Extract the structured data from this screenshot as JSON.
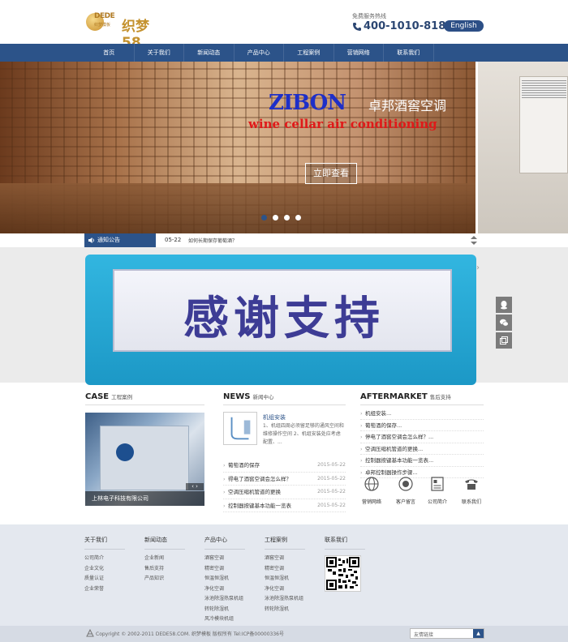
{
  "header": {
    "logo_text1": "DEDE",
    "logo_text2": "织梦模板",
    "logo_text3": "织梦58",
    "hotline_label": "免费服务热线",
    "hotline_number": "400-1010-818",
    "lang_button": "English"
  },
  "nav": {
    "items": [
      "首页",
      "关于我们",
      "新闻动态",
      "产品中心",
      "工程案例",
      "营销网络",
      "联系我们"
    ]
  },
  "banner": {
    "brand": "ZIBON",
    "brand_cn": "卓邦酒窖空调",
    "tagline": "wine cellar air conditioning",
    "button": "立即查看",
    "slide_count": 4,
    "active_slide": 1
  },
  "notice": {
    "label": "通知公告",
    "date": "05-22",
    "text": "如何长期保存葡萄酒？"
  },
  "promo": {
    "text": "感谢支持"
  },
  "case": {
    "title": "CASE",
    "subtitle": "工程案例",
    "caption": "上林电子科技有限公司",
    "nav": "‹  ›"
  },
  "news": {
    "title": "NEWS",
    "subtitle": "新闻中心",
    "featured_title": "机组安装",
    "featured_desc": "1、机组四周必须留足够的通风空间和维修操作空间 2、机组安装处应考虑配置、...",
    "items": [
      {
        "title": "葡萄酒的保存",
        "date": "2015-05-22"
      },
      {
        "title": "得电了酒窖空调会怎么样？",
        "date": "2015-05-22"
      },
      {
        "title": "空调压缩机管道的更换",
        "date": "2015-05-22"
      },
      {
        "title": "控制器按键基本功能一览表",
        "date": "2015-05-22"
      }
    ]
  },
  "aftermarket": {
    "title": "AFTERMARKET",
    "subtitle": "售后支持",
    "items": [
      "机组安装...",
      "葡萄酒的保存...",
      "停电了酒窖空调会怎么样？...",
      "空调压缩机管道的更换...",
      "控制器按键基本功能一览表...",
      "卓邦控制器操作步骤..."
    ],
    "services": [
      {
        "label": "营销网络",
        "icon": "globe-icon"
      },
      {
        "label": "客户留言",
        "icon": "message-icon"
      },
      {
        "label": "公司简介",
        "icon": "document-icon"
      },
      {
        "label": "联系我们",
        "icon": "telephone-icon"
      }
    ]
  },
  "footer": {
    "columns": [
      {
        "heading": "关于我们",
        "items": [
          "公司简介",
          "企业文化",
          "质量认证",
          "企业荣誉"
        ]
      },
      {
        "heading": "新闻动态",
        "items": [
          "企业新闻",
          "售后支持",
          "产品知识"
        ]
      },
      {
        "heading": "产品中心",
        "items": [
          "酒窖空调",
          "精密空调",
          "恒温恒湿机",
          "净化空调",
          "泳池除湿热泵机组",
          "转轮除湿机",
          "风冷模块机组"
        ]
      },
      {
        "heading": "工程案例",
        "items": [
          "酒窖空调",
          "精密空调",
          "恒温恒湿机",
          "净化空调",
          "泳池除湿热泵机组",
          "转轮除湿机"
        ]
      },
      {
        "heading": "联系我们",
        "items": []
      }
    ],
    "copyright": "Copyright © 2002-2011 DEDE58.COM. 织梦模板 版权所有 Tel:ICP备00000336号",
    "links_select": "友情链接",
    "links_btn": "▲"
  },
  "colors": {
    "primary": "#2c5389",
    "accent_red": "#e01919",
    "brand_blue": "#1e2fc8",
    "gold": "#c4922f"
  }
}
